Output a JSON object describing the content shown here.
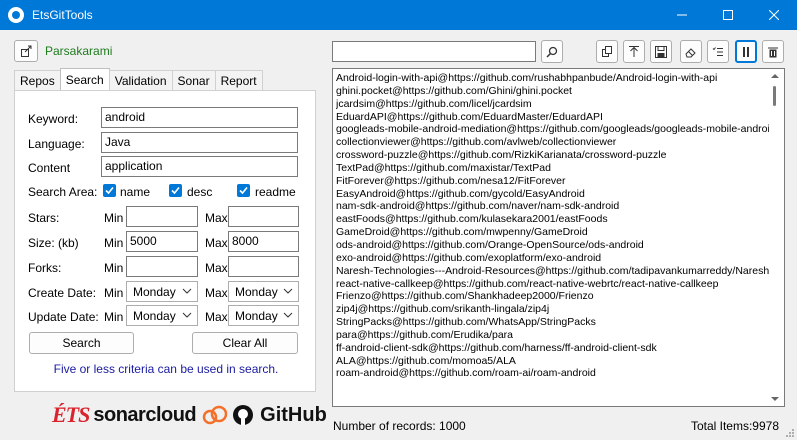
{
  "window": {
    "title": "EtsGitTools"
  },
  "user": {
    "name": "Parsakarami"
  },
  "tabs": [
    "Repos",
    "Search",
    "Validation",
    "Sonar",
    "Report"
  ],
  "active_tab": "Search",
  "form": {
    "keyword_label": "Keyword:",
    "keyword_value": "android",
    "language_label": "Language:",
    "language_value": "Java",
    "content_label": "Content",
    "content_value": "application",
    "search_area_label": "Search Area:",
    "area_name": "name",
    "area_desc": "desc",
    "area_readme": "readme",
    "stars_label": "Stars:",
    "size_label": "Size: (kb)",
    "forks_label": "Forks:",
    "create_date_label": "Create Date:",
    "update_date_label": "Update Date:",
    "min_label": "Min",
    "max_label": "Max",
    "size_min": "5000",
    "size_max": "8000",
    "day_option": "Monday",
    "search_button": "Search",
    "clear_button": "Clear All",
    "note": "Five or less criteria can be used in search."
  },
  "logos": {
    "ets": "ÉTS",
    "sonar": "sonarcloud",
    "github": "GitHub"
  },
  "results": [
    "Android-login-with-api@https://github.com/rushabhpanbude/Android-login-with-api",
    "ghini.pocket@https://github.com/Ghini/ghini.pocket",
    "jcardsim@https://github.com/licel/jcardsim",
    "EduardAPI@https://github.com/EduardMaster/EduardAPI",
    "googleads-mobile-android-mediation@https://github.com/googleads/googleads-mobile-android",
    "collectionviewer@https://github.com/avlweb/collectionviewer",
    "crossword-puzzle@https://github.com/RizkiKarianata/crossword-puzzle",
    "TextPad@https://github.com/maxistar/TextPad",
    "FitForever@https://github.com/nesa12/FitForever",
    "EasyAndroid@https://github.com/gycold/EasyAndroid",
    "nam-sdk-android@https://github.com/naver/nam-sdk-android",
    "eastFoods@https://github.com/kulasekara2001/eastFoods",
    "GameDroid@https://github.com/mwpenny/GameDroid",
    "ods-android@https://github.com/Orange-OpenSource/ods-android",
    "exo-android@https://github.com/exoplatform/exo-android",
    "Naresh-Technologies---Android-Resources@https://github.com/tadipavankumarreddy/Naresh-Te",
    "react-native-callkeep@https://github.com/react-native-webrtc/react-native-callkeep",
    "Frienzo@https://github.com/Shankhadeep2000/Frienzo",
    "zip4j@https://github.com/srikanth-lingala/zip4j",
    "StringPacks@https://github.com/WhatsApp/StringPacks",
    "para@https://github.com/Erudika/para",
    "ff-android-client-sdk@https://github.com/harness/ff-android-client-sdk",
    "ALA@https://github.com/momoa5/ALA",
    "roam-android@https://github.com/roam-ai/roam-android"
  ],
  "status": {
    "records": "Number of records: 1000",
    "total": "Total Items:9978"
  },
  "colors": {
    "titlebar": "#0078d7",
    "accent": "#0078d7",
    "user_name": "#1e7b1e",
    "note": "#1a1aa0",
    "ets_red": "#d9232d",
    "sonar_orange": "#f3702a"
  }
}
